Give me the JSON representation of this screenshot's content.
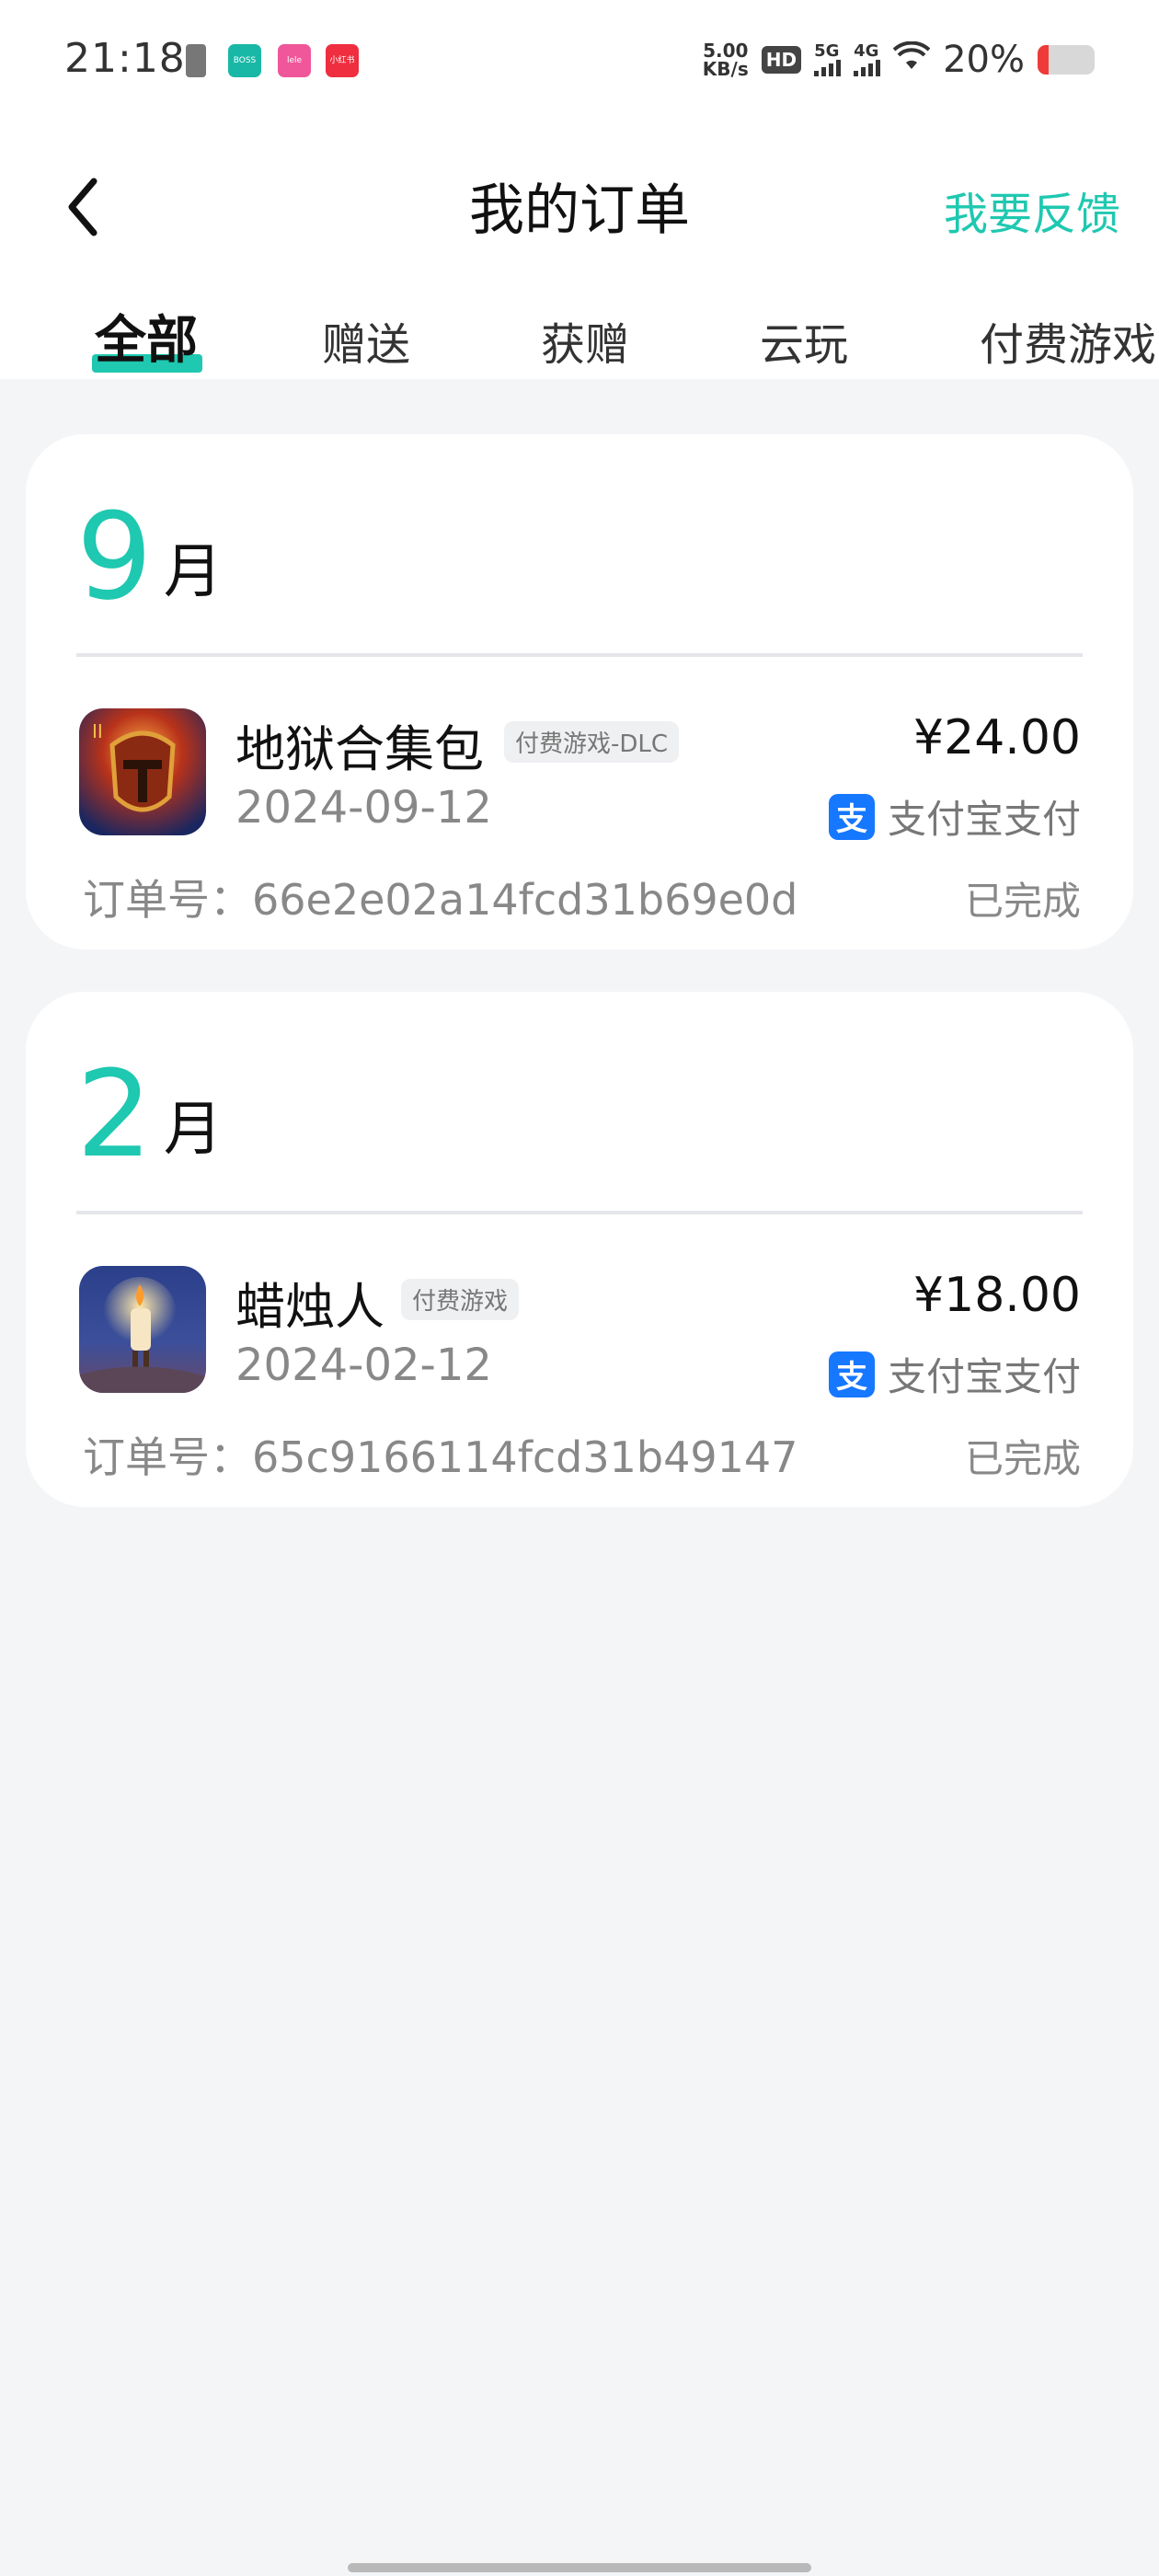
{
  "status_bar": {
    "time": "21:18",
    "speed": "5.00",
    "speed_unit": "KB/s",
    "hd": "HD",
    "net1": "5G",
    "net2": "4G",
    "battery_pct": "20%",
    "battery_level": 0.2,
    "apps": [
      "BOSS直聘",
      "lele",
      "小红书"
    ]
  },
  "header": {
    "back_icon": "chevron-left-icon",
    "title": "我的订单",
    "feedback": "我要反馈"
  },
  "tabs": [
    {
      "label": "全部",
      "active": true
    },
    {
      "label": "赠送",
      "active": false
    },
    {
      "label": "获赠",
      "active": false
    },
    {
      "label": "云玩",
      "active": false
    },
    {
      "label": "付费游戏",
      "active": false
    }
  ],
  "orders": [
    {
      "month": "9",
      "month_unit": "月",
      "name": "地狱合集包",
      "tag": "付费游戏-DLC",
      "date": "2024-09-12",
      "price": "¥24.00",
      "pay_icon": "支",
      "pay_method": "支付宝支付",
      "order_no": "订单号：66e2e02a14fcd31b69e0d",
      "status": "已完成"
    },
    {
      "month": "2",
      "month_unit": "月",
      "name": "蜡烛人",
      "tag": "付费游戏",
      "date": "2024-02-12",
      "price": "¥18.00",
      "pay_icon": "支",
      "pay_method": "支付宝支付",
      "order_no": "订单号：65c9166114fcd31b49147",
      "status": "已完成"
    }
  ],
  "colors": {
    "accent": "#1fc8b0",
    "alipay": "#1677ff",
    "background": "#f4f5f7"
  }
}
